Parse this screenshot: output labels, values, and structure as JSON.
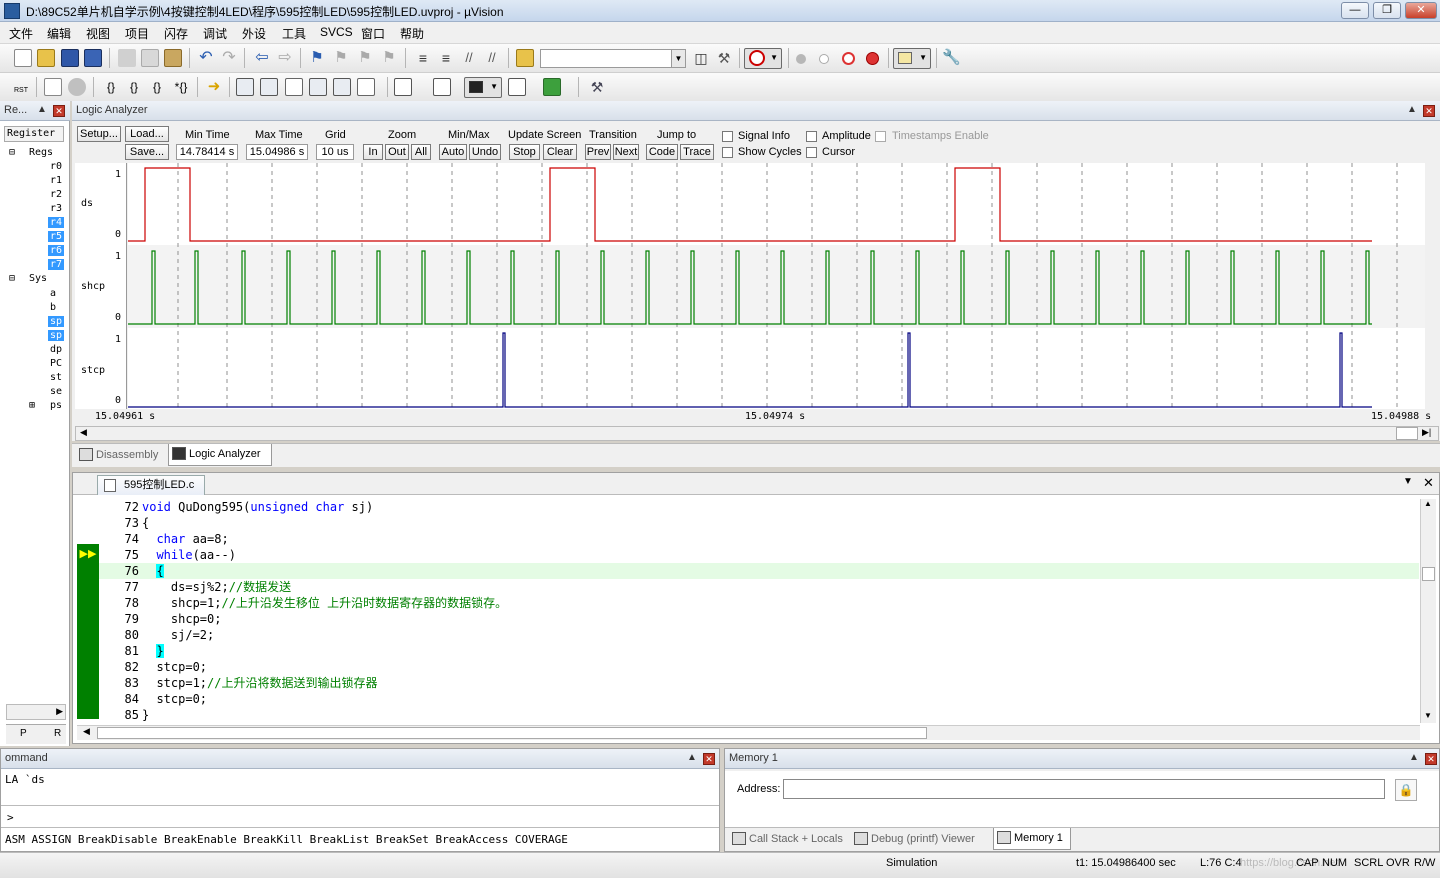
{
  "window": {
    "title": "D:\\89C52单片机自学示例\\4按键控制4LED\\程序\\595控制LED\\595控制LED.uvproj - µVision"
  },
  "menu": [
    "文件",
    "编辑",
    "视图",
    "项目",
    "闪存",
    "调试",
    "外设",
    "工具",
    "SVCS",
    "窗口",
    "帮助"
  ],
  "toolbar2": {
    "rst_label": "RST"
  },
  "registers": {
    "panel_title": "Re...",
    "header": "Register",
    "regs_group": "Regs",
    "regs": [
      "r0",
      "r1",
      "r2",
      "r3",
      "r4",
      "r5",
      "r6",
      "r7"
    ],
    "sys_group": "Sys",
    "sys": [
      "a",
      "b",
      "sp",
      "sp",
      "dp",
      "PC",
      "st",
      "se",
      "ps"
    ],
    "tab_p": "P",
    "tab_r": "R"
  },
  "logic_analyzer": {
    "title": "Logic Analyzer",
    "setup": "Setup...",
    "load": "Load...",
    "save": "Save...",
    "min_time_label": "Min Time",
    "min_time": "14.78414 s",
    "max_time_label": "Max Time",
    "max_time": "15.04986 s",
    "grid_label": "Grid",
    "grid": "10 us",
    "zoom_label": "Zoom",
    "zoom_in": "In",
    "zoom_out": "Out",
    "zoom_all": "All",
    "minmax_label": "Min/Max",
    "auto": "Auto",
    "undo": "Undo",
    "update_label": "Update Screen",
    "stop": "Stop",
    "clear": "Clear",
    "transition_label": "Transition",
    "prev": "Prev",
    "next": "Next",
    "jump_label": "Jump to",
    "code": "Code",
    "trace": "Trace",
    "signal_info": "Signal Info",
    "show_cycles": "Show Cycles",
    "amplitude": "Amplitude",
    "cursor": "Cursor",
    "timestamps": "Timestamps Enable",
    "signals": [
      "ds",
      "shcp",
      "stcp"
    ],
    "one": "1",
    "zero": "0",
    "t_left": "15.04961  s",
    "t_mid": "15.04974  s",
    "t_right": "15.04988  s",
    "colors": {
      "ds": "#cc0000",
      "shcp": "#008000",
      "stcp": "#000080"
    }
  },
  "view_tabs": {
    "disassembly": "Disassembly",
    "logic_analyzer": "Logic Analyzer"
  },
  "editor": {
    "file_tab": "595控制LED.c",
    "lines": [
      {
        "n": "72",
        "html": "<span class='kw'>void</span> QuDong595(<span class='kw'>unsigned</span> <span class='kw'>char</span> sj)"
      },
      {
        "n": "73",
        "html": "{"
      },
      {
        "n": "74",
        "html": "  <span class='kw'>char</span> aa=8;"
      },
      {
        "n": "75",
        "html": "  <span class='kw'>while</span>(aa--)"
      },
      {
        "n": "76",
        "html": "  <span style='background:#00ffff'>{</span>"
      },
      {
        "n": "77",
        "html": "    ds=sj%2;<span class='cm'>//数据发送</span>"
      },
      {
        "n": "78",
        "html": "    shcp=1;<span class='cm'>//上升沿发生移位 上升沿时数据寄存器的数据锁存。</span>"
      },
      {
        "n": "79",
        "html": "    shcp=0;"
      },
      {
        "n": "80",
        "html": "    sj/=2;"
      },
      {
        "n": "81",
        "html": "  <span style='background:#00ffff'>}</span>"
      },
      {
        "n": "82",
        "html": "  stcp=0;"
      },
      {
        "n": "83",
        "html": "  stcp=1;<span class='cm'>//上升沿将数据送到输出锁存器</span>"
      },
      {
        "n": "84",
        "html": "  stcp=0;"
      },
      {
        "n": "85",
        "html": "}"
      }
    ]
  },
  "command": {
    "title": "ommand",
    "output": "LA `ds",
    "prompt": ">",
    "hints": "ASM ASSIGN BreakDisable BreakEnable BreakKill BreakList BreakSet BreakAccess COVERAGE"
  },
  "memory": {
    "title": "Memory 1",
    "address_label": "Address:",
    "address_value": ""
  },
  "bottom_tabs": {
    "callstack": "Call Stack + Locals",
    "debug": "Debug (printf) Viewer",
    "memory": "Memory 1"
  },
  "status": {
    "mode": "Simulation",
    "time": "t1: 15.04986400 sec",
    "pos": "L:76 C:4",
    "caps": "CAP",
    "num": "NUM",
    "scrl": "SCRL",
    "ovr": "OVR",
    "rw": "R/W",
    "watermark": "https://blog.csdn.net/"
  }
}
